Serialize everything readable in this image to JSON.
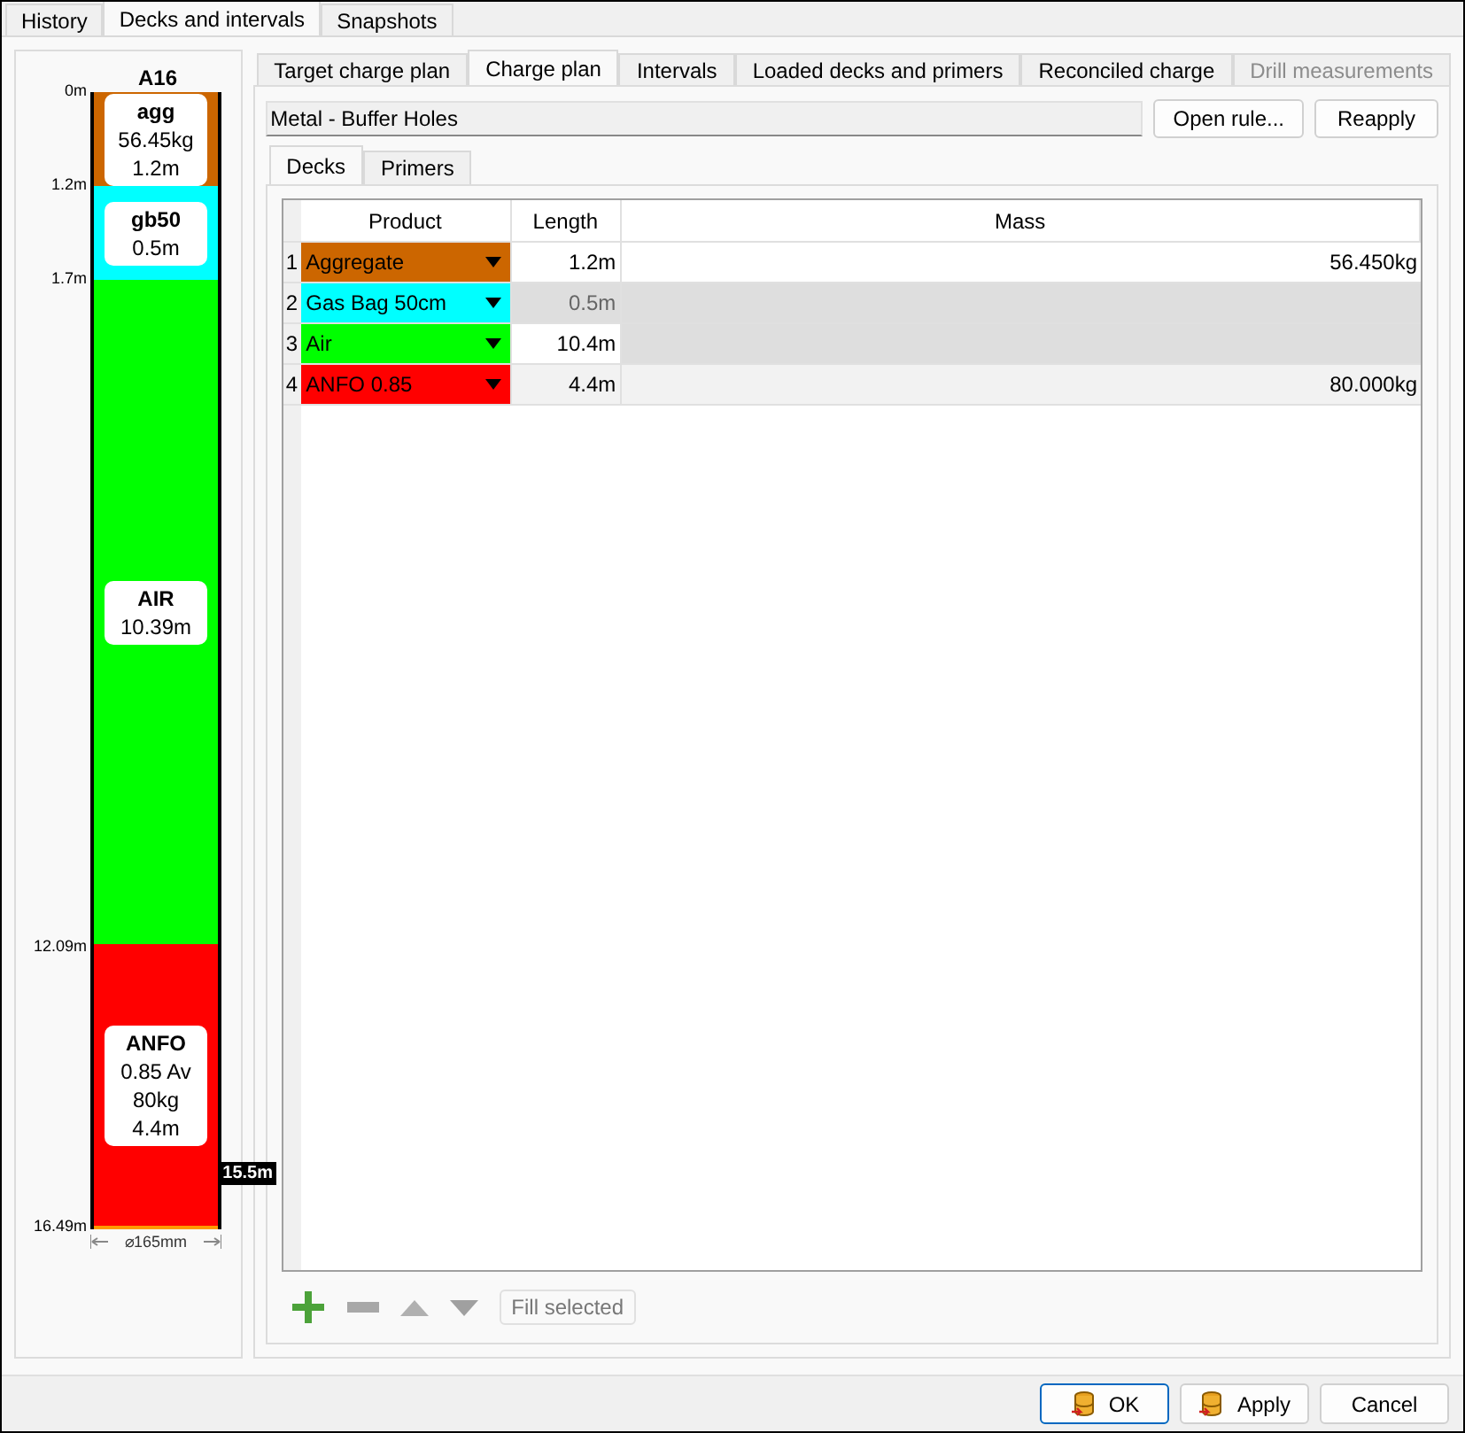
{
  "top_tabs": [
    {
      "label": "History",
      "selected": false
    },
    {
      "label": "Decks and intervals",
      "selected": true
    },
    {
      "label": "Snapshots",
      "selected": false
    }
  ],
  "hole": {
    "title": "A16",
    "segments": [
      {
        "name": "agg",
        "lines": [
          "56.45kg",
          "1.2m"
        ],
        "top": "0m",
        "color": "#cc6600"
      },
      {
        "name": "gb50",
        "lines": [
          "0.5m"
        ],
        "top": "1.2m",
        "color": "#00ffff"
      },
      {
        "name": "AIR",
        "lines": [
          "10.39m"
        ],
        "top": "1.7m",
        "color": "#00ff00"
      },
      {
        "name": "ANFO",
        "lines": [
          "0.85 Av",
          "80kg",
          "4.4m"
        ],
        "top": "12.09m",
        "color": "#ff0000"
      }
    ],
    "bottom": "16.49m",
    "marker": "15.5m",
    "diameter": "⌀165mm"
  },
  "tabs": [
    {
      "label": "Target charge plan",
      "selected": false,
      "disabled": false
    },
    {
      "label": "Charge plan",
      "selected": true,
      "disabled": false
    },
    {
      "label": "Intervals",
      "selected": false,
      "disabled": false
    },
    {
      "label": "Loaded decks and primers",
      "selected": false,
      "disabled": false
    },
    {
      "label": "Reconciled charge",
      "selected": false,
      "disabled": false
    },
    {
      "label": "Drill measurements",
      "selected": false,
      "disabled": true
    }
  ],
  "rule": {
    "value": "Metal - Buffer Holes",
    "buttons": [
      "Open rule...",
      "Reapply"
    ]
  },
  "sub_tabs": [
    {
      "label": "Decks",
      "selected": true
    },
    {
      "label": "Primers",
      "selected": false
    }
  ],
  "table": {
    "columns": [
      "Product",
      "Length",
      "Mass"
    ],
    "rows": [
      {
        "index": "1",
        "product": "Aggregate",
        "color": "#cc6600",
        "length": "1.2m",
        "length_disabled": false,
        "mass": "56.450kg",
        "mass_disabled": false
      },
      {
        "index": "2",
        "product": "Gas Bag 50cm",
        "color": "#00ffff",
        "length": "0.5m",
        "length_disabled": true,
        "mass_disabled": true
      },
      {
        "index": "3",
        "product": "Air",
        "color": "#00ff00",
        "length": "10.4m",
        "length_disabled": false,
        "mass_disabled": true
      },
      {
        "index": "4",
        "product": "ANFO 0.85",
        "color": "#ff0000",
        "length": "4.4m",
        "length_disabled": false,
        "mass": "80.000kg",
        "mass_disabled": false
      }
    ]
  },
  "toolbar": {
    "fill_button": {
      "label": "Fill selected",
      "disabled": true
    }
  },
  "buttons": [
    {
      "label": "OK",
      "kind": "icon",
      "focused": true
    },
    {
      "label": "Apply",
      "kind": "icon",
      "focused": false
    },
    {
      "label": "Cancel",
      "kind": "plain",
      "focused": false
    }
  ]
}
